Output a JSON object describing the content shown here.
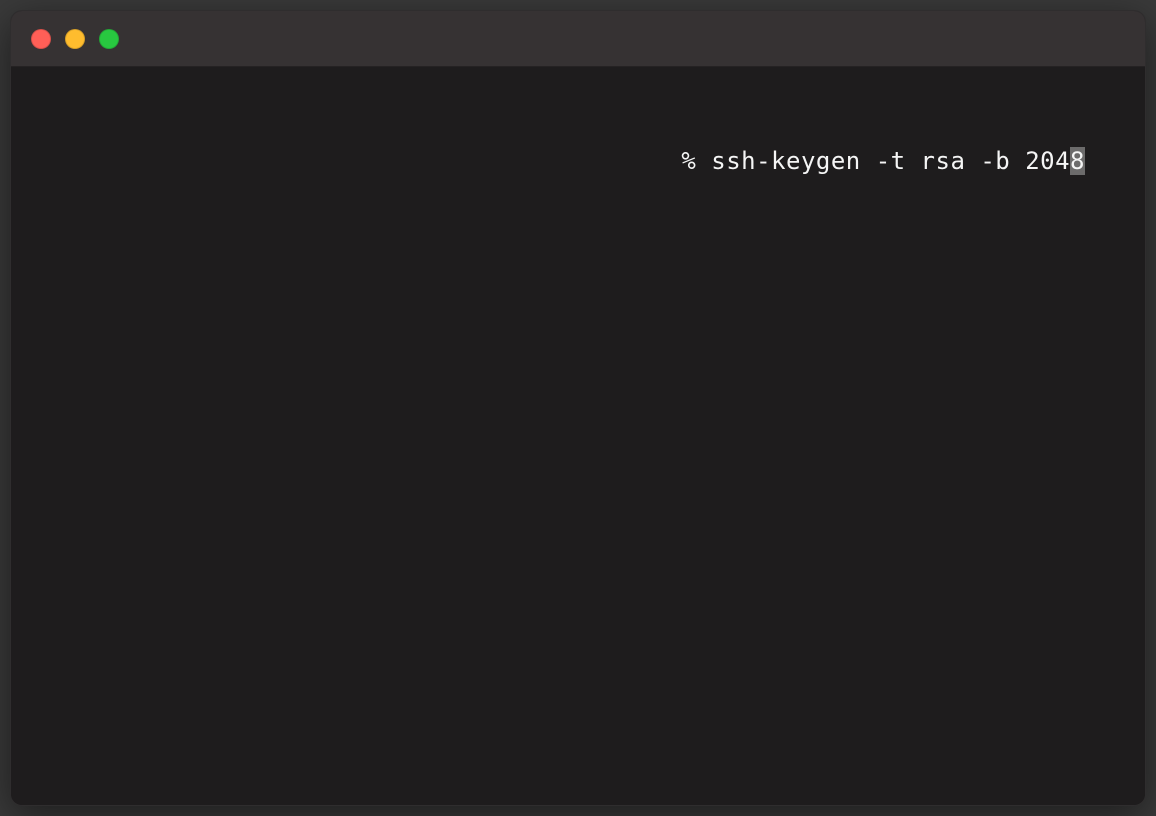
{
  "terminal": {
    "prompt": "% ",
    "command_before_cursor": "ssh-keygen -t rsa -b 204",
    "cursor_char": "8"
  },
  "window": {
    "traffic_lights": {
      "close": "red",
      "minimize": "yellow",
      "maximize": "green"
    }
  }
}
